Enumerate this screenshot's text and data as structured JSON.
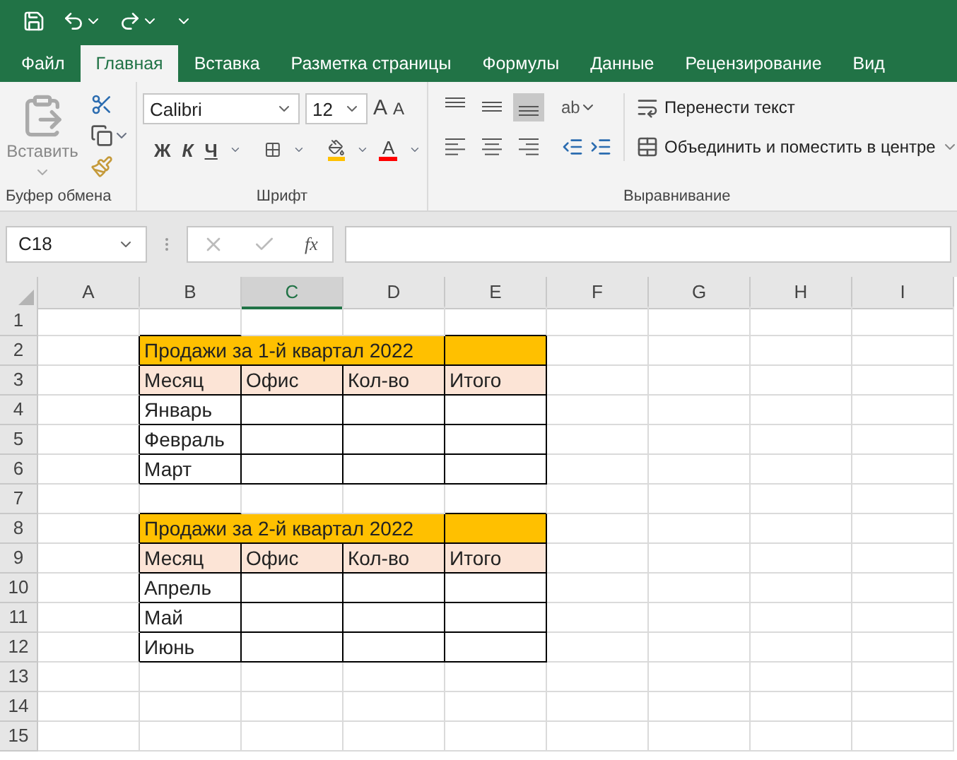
{
  "tabs": [
    {
      "label": "Файл",
      "selected": false
    },
    {
      "label": "Главная",
      "selected": true
    },
    {
      "label": "Вставка",
      "selected": false
    },
    {
      "label": "Разметка страницы",
      "selected": false
    },
    {
      "label": "Формулы",
      "selected": false
    },
    {
      "label": "Данные",
      "selected": false
    },
    {
      "label": "Рецензирование",
      "selected": false
    },
    {
      "label": "Вид",
      "selected": false
    }
  ],
  "ribbon": {
    "clipboard": {
      "paste_label": "Вставить",
      "group_label": "Буфер обмена"
    },
    "font": {
      "name": "Calibri",
      "size": "12",
      "grow_label": "A",
      "shrink_label": "A",
      "style_buttons": [
        {
          "label": "Ж",
          "kind": "bold"
        },
        {
          "label": "К",
          "kind": "italic"
        },
        {
          "label": "Ч",
          "kind": "underline"
        }
      ],
      "font_color_label": "A",
      "group_label": "Шрифт"
    },
    "alignment": {
      "vertical": [
        {
          "kind": "top",
          "selected": false
        },
        {
          "kind": "middle",
          "selected": false
        },
        {
          "kind": "bottom",
          "selected": true
        }
      ],
      "orientation_label": "ab",
      "horizontal": [
        {
          "kind": "left",
          "selected": false
        },
        {
          "kind": "center",
          "selected": false
        },
        {
          "kind": "right",
          "selected": false
        }
      ],
      "wrap_label": "Перенести текст",
      "merge_label": "Объединить и поместить в центре",
      "group_label": "Выравнивание"
    }
  },
  "formula_bar": {
    "name_box": "C18",
    "fx_label": "fx"
  },
  "sheet": {
    "columns": [
      {
        "label": "A",
        "selected": false
      },
      {
        "label": "B",
        "selected": false
      },
      {
        "label": "C",
        "selected": true
      },
      {
        "label": "D",
        "selected": false
      },
      {
        "label": "E",
        "selected": false
      },
      {
        "label": "F",
        "selected": false
      },
      {
        "label": "G",
        "selected": false
      },
      {
        "label": "H",
        "selected": false
      },
      {
        "label": "I",
        "selected": false
      }
    ],
    "rows": [
      {
        "label": "1",
        "cells": [
          {
            "kind": "empty"
          },
          {
            "kind": "empty"
          },
          {
            "kind": "empty"
          },
          {
            "kind": "empty"
          },
          {
            "kind": "empty"
          },
          {
            "kind": "empty"
          },
          {
            "kind": "empty"
          },
          {
            "kind": "empty"
          },
          {
            "kind": "empty"
          }
        ]
      },
      {
        "label": "2",
        "cells": [
          {
            "kind": "empty"
          },
          {
            "kind": "title",
            "text": "Продажи за 1-й квартал 2022"
          },
          {
            "kind": "merged"
          },
          {
            "kind": "merged"
          },
          {
            "kind": "title"
          },
          {
            "kind": "empty"
          },
          {
            "kind": "empty"
          },
          {
            "kind": "empty"
          },
          {
            "kind": "empty"
          }
        ]
      },
      {
        "label": "3",
        "cells": [
          {
            "kind": "empty"
          },
          {
            "kind": "header",
            "text": "Месяц"
          },
          {
            "kind": "header",
            "text": "Офис"
          },
          {
            "kind": "header",
            "text": "Кол-во"
          },
          {
            "kind": "header",
            "text": "Итого"
          },
          {
            "kind": "empty"
          },
          {
            "kind": "empty"
          },
          {
            "kind": "empty"
          },
          {
            "kind": "empty"
          }
        ]
      },
      {
        "label": "4",
        "cells": [
          {
            "kind": "empty"
          },
          {
            "kind": "data",
            "text": "Январь"
          },
          {
            "kind": "data"
          },
          {
            "kind": "data"
          },
          {
            "kind": "data"
          },
          {
            "kind": "empty"
          },
          {
            "kind": "empty"
          },
          {
            "kind": "empty"
          },
          {
            "kind": "empty"
          }
        ]
      },
      {
        "label": "5",
        "cells": [
          {
            "kind": "empty"
          },
          {
            "kind": "data",
            "text": "Февраль"
          },
          {
            "kind": "data"
          },
          {
            "kind": "data"
          },
          {
            "kind": "data"
          },
          {
            "kind": "empty"
          },
          {
            "kind": "empty"
          },
          {
            "kind": "empty"
          },
          {
            "kind": "empty"
          }
        ]
      },
      {
        "label": "6",
        "cells": [
          {
            "kind": "empty"
          },
          {
            "kind": "data",
            "text": "Март"
          },
          {
            "kind": "data"
          },
          {
            "kind": "data"
          },
          {
            "kind": "data"
          },
          {
            "kind": "empty"
          },
          {
            "kind": "empty"
          },
          {
            "kind": "empty"
          },
          {
            "kind": "empty"
          }
        ]
      },
      {
        "label": "7",
        "cells": [
          {
            "kind": "empty"
          },
          {
            "kind": "empty"
          },
          {
            "kind": "empty"
          },
          {
            "kind": "empty"
          },
          {
            "kind": "empty"
          },
          {
            "kind": "empty"
          },
          {
            "kind": "empty"
          },
          {
            "kind": "empty"
          },
          {
            "kind": "empty"
          }
        ]
      },
      {
        "label": "8",
        "cells": [
          {
            "kind": "empty"
          },
          {
            "kind": "title",
            "text": "Продажи за 2-й квартал 2022"
          },
          {
            "kind": "merged"
          },
          {
            "kind": "merged"
          },
          {
            "kind": "title"
          },
          {
            "kind": "empty"
          },
          {
            "kind": "empty"
          },
          {
            "kind": "empty"
          },
          {
            "kind": "empty"
          }
        ]
      },
      {
        "label": "9",
        "cells": [
          {
            "kind": "empty"
          },
          {
            "kind": "header",
            "text": "Месяц"
          },
          {
            "kind": "header",
            "text": "Офис"
          },
          {
            "kind": "header",
            "text": "Кол-во"
          },
          {
            "kind": "header",
            "text": "Итого"
          },
          {
            "kind": "empty"
          },
          {
            "kind": "empty"
          },
          {
            "kind": "empty"
          },
          {
            "kind": "empty"
          }
        ]
      },
      {
        "label": "10",
        "cells": [
          {
            "kind": "empty"
          },
          {
            "kind": "data",
            "text": "Апрель"
          },
          {
            "kind": "data"
          },
          {
            "kind": "data"
          },
          {
            "kind": "data"
          },
          {
            "kind": "empty"
          },
          {
            "kind": "empty"
          },
          {
            "kind": "empty"
          },
          {
            "kind": "empty"
          }
        ]
      },
      {
        "label": "11",
        "cells": [
          {
            "kind": "empty"
          },
          {
            "kind": "data",
            "text": "Май"
          },
          {
            "kind": "data"
          },
          {
            "kind": "data"
          },
          {
            "kind": "data"
          },
          {
            "kind": "empty"
          },
          {
            "kind": "empty"
          },
          {
            "kind": "empty"
          },
          {
            "kind": "empty"
          }
        ]
      },
      {
        "label": "12",
        "cells": [
          {
            "kind": "empty"
          },
          {
            "kind": "data",
            "text": "Июнь"
          },
          {
            "kind": "data"
          },
          {
            "kind": "data"
          },
          {
            "kind": "data"
          },
          {
            "kind": "empty"
          },
          {
            "kind": "empty"
          },
          {
            "kind": "empty"
          },
          {
            "kind": "empty"
          }
        ]
      },
      {
        "label": "13",
        "cells": [
          {
            "kind": "empty"
          },
          {
            "kind": "empty"
          },
          {
            "kind": "empty"
          },
          {
            "kind": "empty"
          },
          {
            "kind": "empty"
          },
          {
            "kind": "empty"
          },
          {
            "kind": "empty"
          },
          {
            "kind": "empty"
          },
          {
            "kind": "empty"
          }
        ]
      },
      {
        "label": "14",
        "cells": [
          {
            "kind": "empty"
          },
          {
            "kind": "empty"
          },
          {
            "kind": "empty"
          },
          {
            "kind": "empty"
          },
          {
            "kind": "empty"
          },
          {
            "kind": "empty"
          },
          {
            "kind": "empty"
          },
          {
            "kind": "empty"
          },
          {
            "kind": "empty"
          }
        ]
      },
      {
        "label": "15",
        "cells": [
          {
            "kind": "empty"
          },
          {
            "kind": "empty"
          },
          {
            "kind": "empty"
          },
          {
            "kind": "empty"
          },
          {
            "kind": "empty"
          },
          {
            "kind": "empty"
          },
          {
            "kind": "empty"
          },
          {
            "kind": "empty"
          },
          {
            "kind": "empty"
          }
        ]
      }
    ]
  }
}
